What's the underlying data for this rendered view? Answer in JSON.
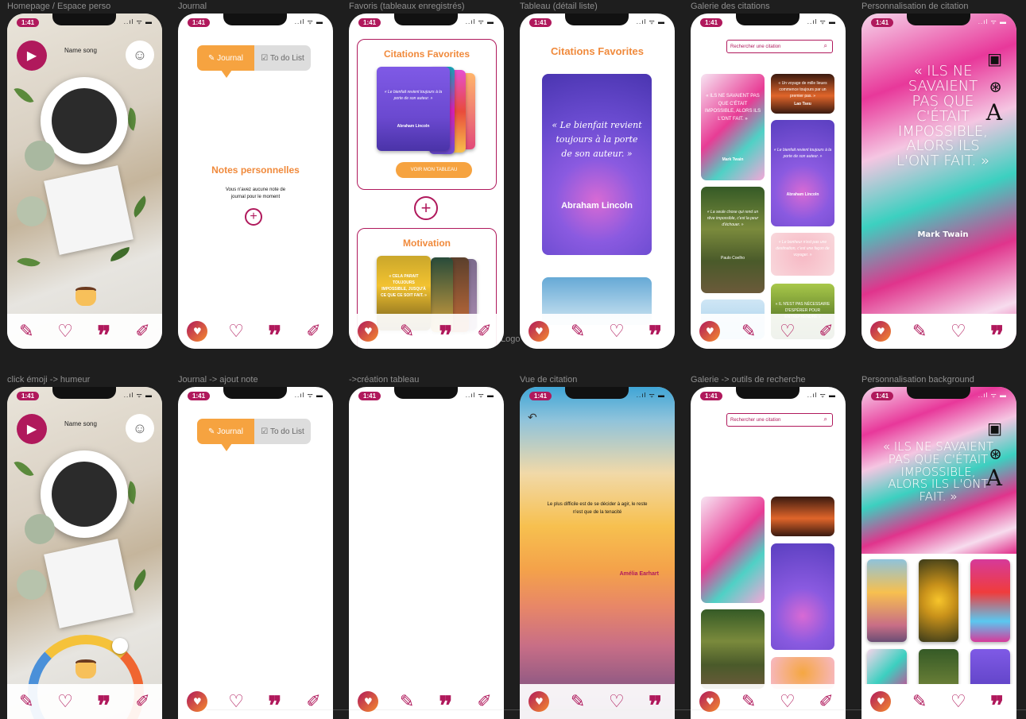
{
  "frames": {
    "homepage": "Homepage / Espace perso",
    "journal": "Journal",
    "favoris": "Favoris (tableaux enregistrés)",
    "tableau": "Tableau (détail liste)",
    "galerie": "Galerie des citations",
    "perso": "Personnalisation de citation",
    "emoji": "click émoji -> humeur",
    "journal_add": "Journal -> ajout note",
    "creation": "->création tableau",
    "vue": "Vue de citation",
    "galerie_search": "Galerie -> outils de recherche",
    "perso_bg": "Personnalisation background"
  },
  "status": {
    "time": "1:41",
    "icons": "..ıl ᯤ ▬"
  },
  "home": {
    "song": "Name song"
  },
  "journal": {
    "tab_journal": "Journal",
    "tab_todo": "To do List",
    "title": "Notes personnelles",
    "empty_line1": "Vous n'avez aucune note de",
    "empty_line2": "journal pour le moment"
  },
  "favoris": {
    "title1": "Citations Favorites",
    "card_quote": "« Le bienfait revient toujours à la porte de son auteur. »",
    "card_author": "Abraham Lincoln",
    "button": "VOIR MON TABLEAU",
    "title2": "Motivation",
    "card2_quote": "« CELA PARAIT TOUJOURS IMPOSSIBLE, JUSQU'À CE QUE CE SOIT FAIT. »"
  },
  "tableau": {
    "title": "Citations Favorites",
    "quote": "« Le bienfait revient toujours à la porte de son auteur. »",
    "author": "Abraham Lincoln"
  },
  "galerie": {
    "search_placeholder": "Rechercher une citation",
    "c1": "« ILS NE SAVAIENT PAS QUE C'ÉTAIT IMPOSSIBLE, ALORS ILS L'ONT FAIT. »",
    "c1_author": "Mark Twain",
    "c2": "« Un voyage de mille lieues commence toujours par un premier pas. »",
    "c2_author": "Lao Tseu",
    "c3": "« Le bienfait revient toujours à la porte de son auteur. »",
    "c3_author": "Abraham Lincoln",
    "c4": "« La seule chose qui rend un rêve impossible, c'est la peur d'échouer. »",
    "c4_author": "Paulo Coelho",
    "c5": "« Le bonheur n'est pas une destination, c'est une façon de voyager. »",
    "c6": "« IL N'EST PAS NÉCESSAIRE D'ESPÉRER POUR ENTREPRENDRE »"
  },
  "perso": {
    "quote": "« ILS NE SAVAIENT PAS QUE C'ÉTAIT IMPOSSIBLE, ALORS ILS L'ONT FAIT. »",
    "author": "Mark Twain"
  },
  "vue": {
    "quote_line1": "Le plus difficile est de se décider à agir, le reste",
    "quote_line2": "n'est que de la tenacité",
    "author": "Amélia Earhart"
  },
  "ghost_logo": "Logo",
  "colors": {
    "brand": "#b0195c",
    "accent": "#f6a340",
    "canvas": "#1e1e1e"
  }
}
